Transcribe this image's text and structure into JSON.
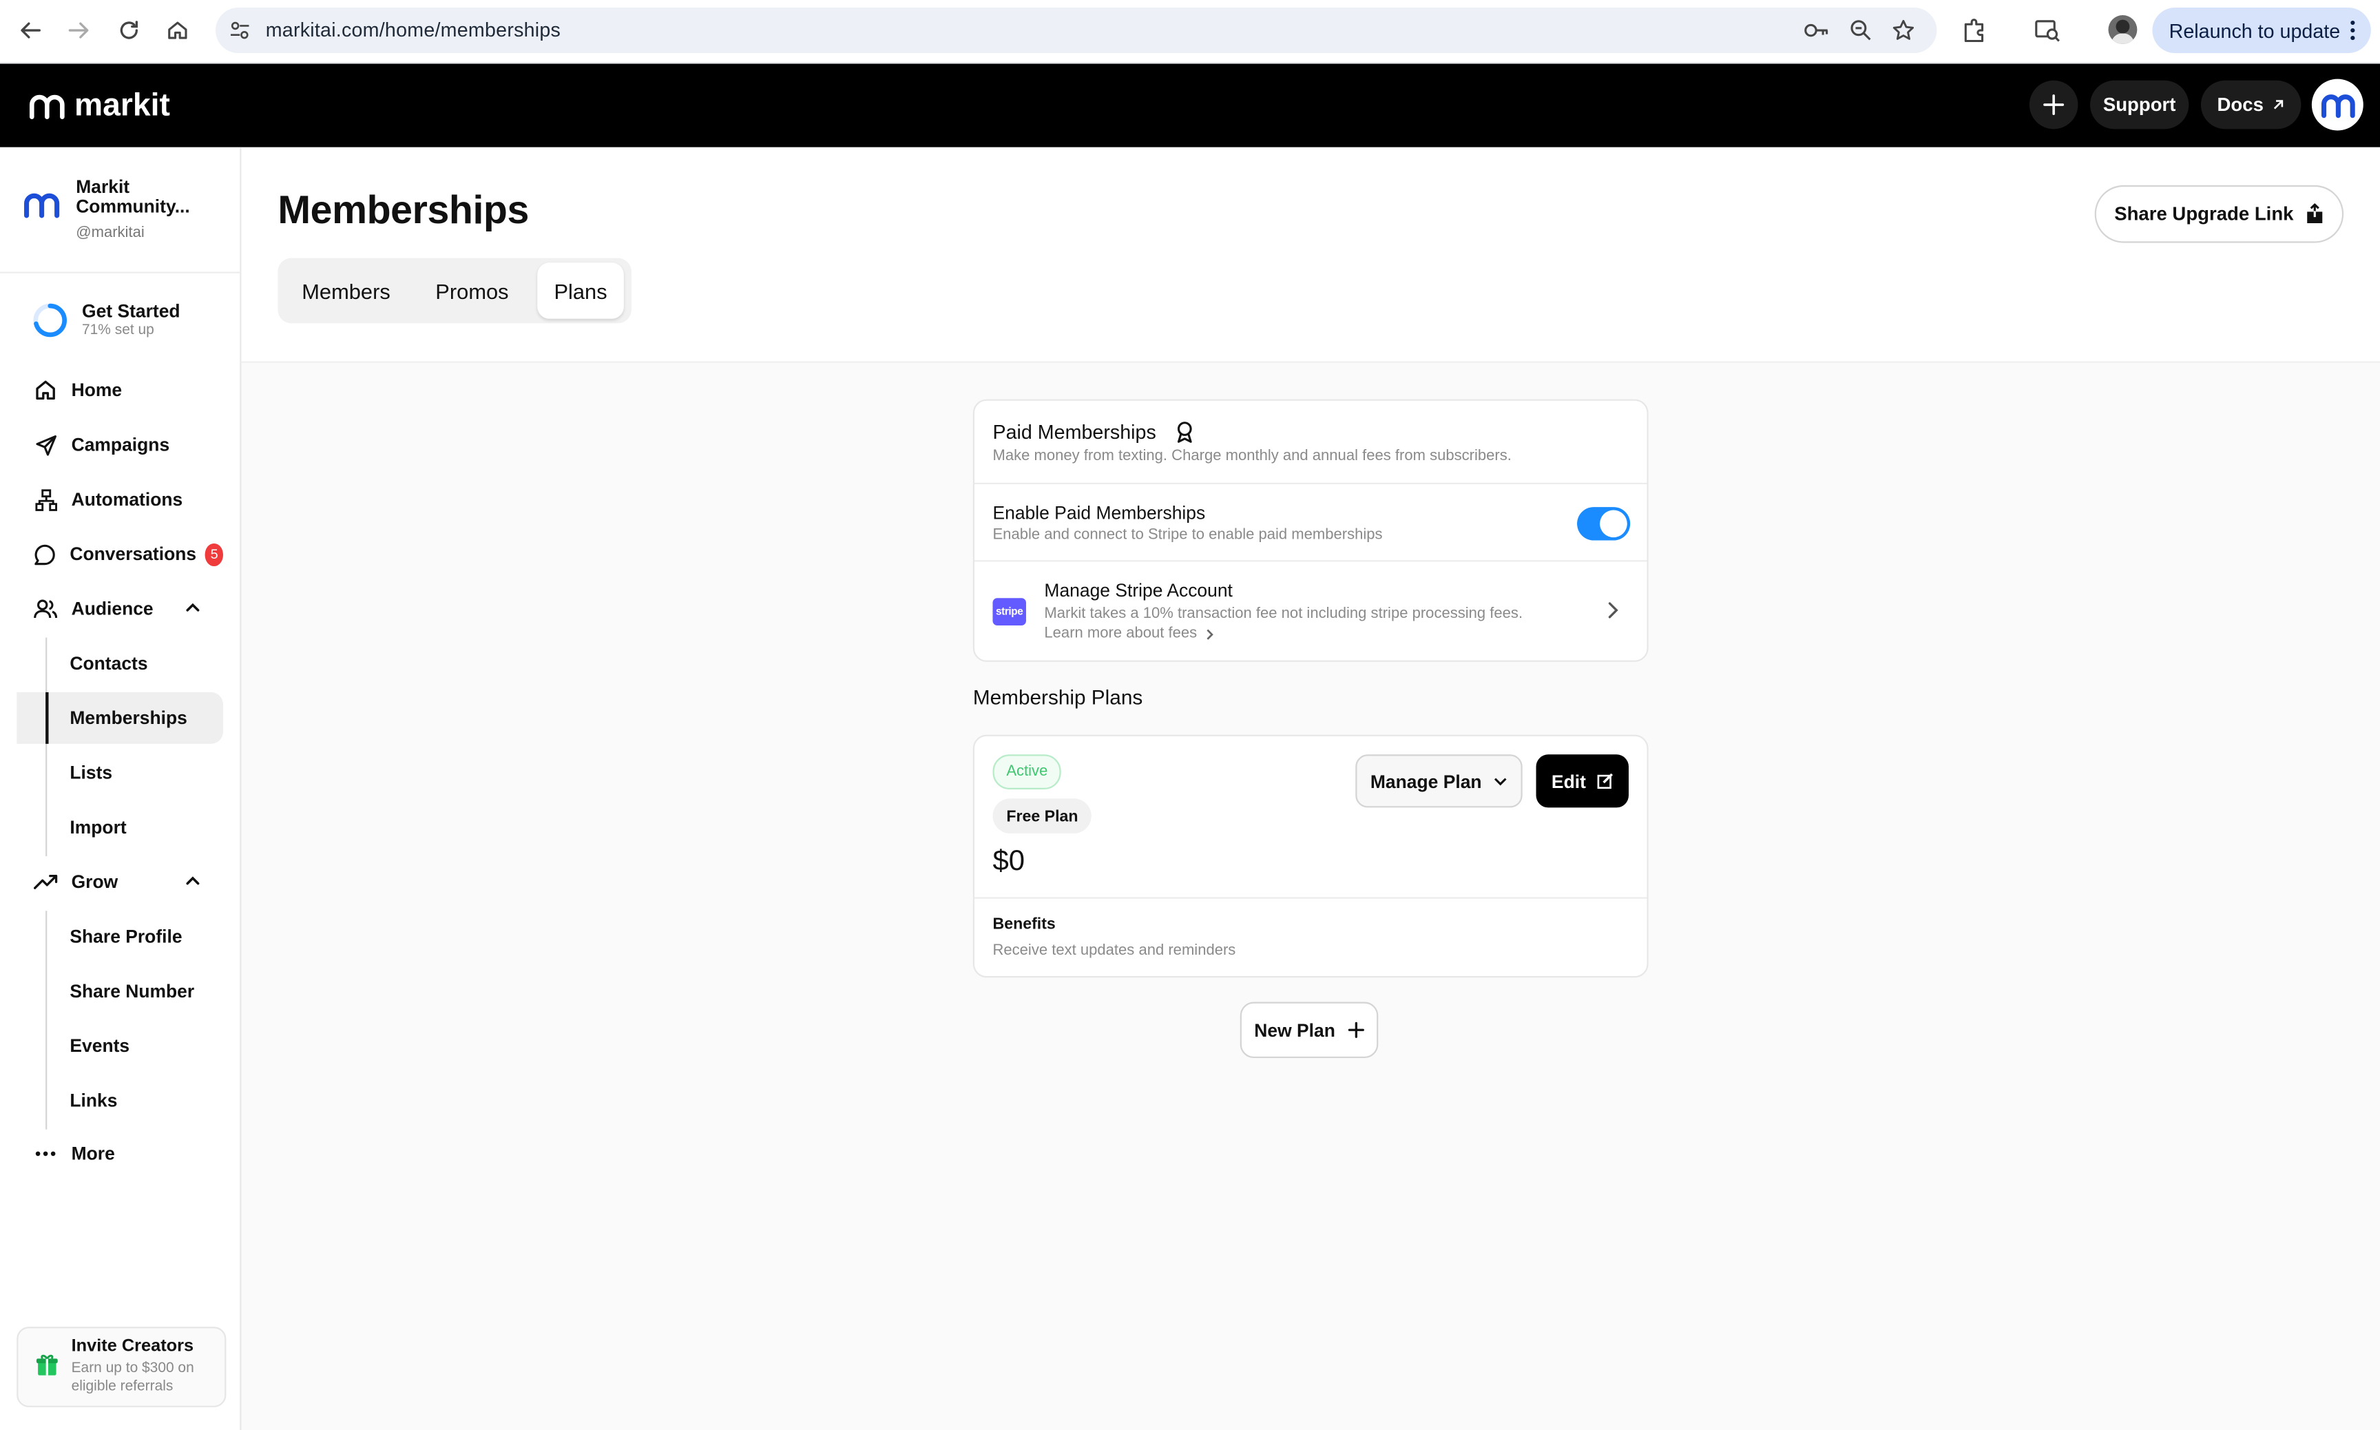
{
  "browser": {
    "url": "markitai.com/home/memberships",
    "relaunch_label": "Relaunch to update"
  },
  "appbar": {
    "brand": "markit",
    "support_label": "Support",
    "docs_label": "Docs"
  },
  "sidebar": {
    "org_name": "Markit Community...",
    "org_handle": "@markitai",
    "get_started": {
      "title": "Get Started",
      "progress_text": "71% set up",
      "progress": 0.71
    },
    "nav": {
      "home": "Home",
      "campaigns": "Campaigns",
      "automations": "Automations",
      "conversations": "Conversations",
      "conversations_badge": "5",
      "audience": "Audience",
      "grow": "Grow",
      "more": "More"
    },
    "audience_items": [
      "Contacts",
      "Memberships",
      "Lists",
      "Import"
    ],
    "grow_items": [
      "Share Profile",
      "Share Number",
      "Events",
      "Links"
    ],
    "invite": {
      "title": "Invite Creators",
      "subtitle": "Earn up to $300 on eligible referrals"
    }
  },
  "header": {
    "title": "Memberships",
    "tabs": [
      "Members",
      "Promos",
      "Plans"
    ],
    "active_tab": "Plans",
    "share_label": "Share Upgrade Link"
  },
  "paid_card": {
    "title": "Paid Memberships",
    "subtitle": "Make money from texting. Charge monthly and annual fees from subscribers.",
    "enable_title": "Enable Paid Memberships",
    "enable_subtitle": "Enable and connect to Stripe to enable paid memberships",
    "enabled": true,
    "stripe_logo_text": "stripe",
    "stripe_title": "Manage Stripe Account",
    "stripe_subtitle": "Markit takes a 10% transaction fee not including stripe processing fees.",
    "learn_more": "Learn more about fees"
  },
  "plans": {
    "section_title": "Membership Plans",
    "items": [
      {
        "status": "Active",
        "name": "Free Plan",
        "price": "$0",
        "manage_label": "Manage Plan",
        "edit_label": "Edit",
        "benefits_label": "Benefits",
        "benefits_text": "Receive text updates and reminders"
      }
    ],
    "new_plan_label": "New Plan"
  },
  "colors": {
    "accent": "#1a8cff",
    "brand_blue": "#1d4ed8",
    "badge_red": "#ef3b3b",
    "active_green": "#3ec76f",
    "stripe": "#635bff"
  }
}
